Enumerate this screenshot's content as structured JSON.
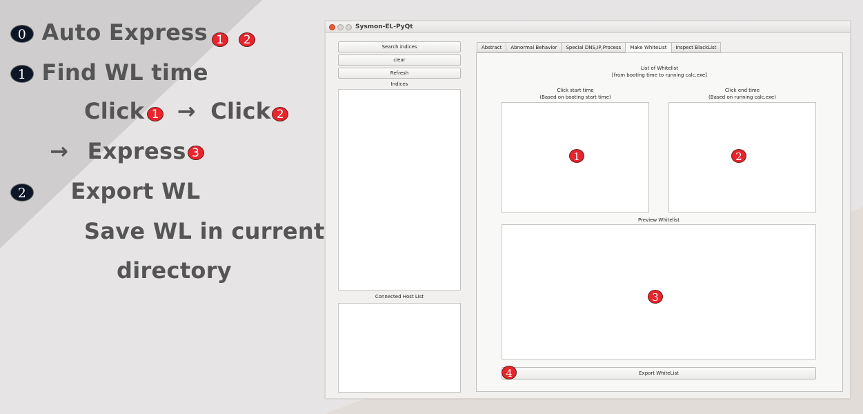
{
  "instructions": {
    "step0": {
      "num": "0",
      "text": "Auto Express",
      "badges": [
        "1",
        "2"
      ]
    },
    "step1": {
      "num": "1",
      "text": "Find WL time"
    },
    "click_line": {
      "click1": "Click",
      "badge1": "1",
      "arrow": "→",
      "click2": "Click",
      "badge2": "2"
    },
    "express_line": {
      "arrow": "→",
      "text": "Express",
      "badge": "3"
    },
    "step2": {
      "num": "2",
      "text": "Export WL"
    },
    "save_line1": "Save WL in current",
    "save_line2": "directory"
  },
  "window": {
    "title": "Sysmon-EL-PyQt",
    "sidebar": {
      "search_button": "Search indices",
      "clear_button": "clear",
      "refresh_button": "Refresh",
      "indices_label": "Indices",
      "host_list_label": "Connected Host List"
    },
    "tabs": [
      "Abstract",
      "Abnormal Behavior",
      "Special DNS,IP,Process",
      "Make WhiteList",
      "Inspect BlackList"
    ],
    "active_tab": "Make WhiteList",
    "panel": {
      "list_title": "List of Whitelist",
      "list_subtitle": "[from booting time to running calc.exe]",
      "start_label": "Click start time",
      "start_sublabel": "(Based on booting start time)",
      "end_label": "Click end time",
      "end_sublabel": "(Based on running calc.exe)",
      "preview_label": "Preview Whitelist",
      "export_button": "Export WhiteList",
      "badge_start": "1",
      "badge_end": "2",
      "badge_preview": "3",
      "badge_export": "4"
    }
  },
  "colors": {
    "badge_red": "#e8242c",
    "badge_black": "#0c1626",
    "text_gray": "#555555"
  }
}
